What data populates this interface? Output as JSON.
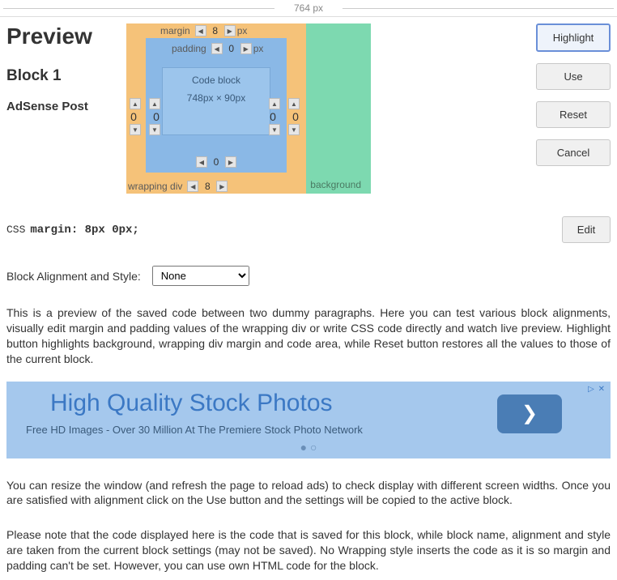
{
  "ruler": "764 px",
  "left": {
    "title": "Preview",
    "block": "Block 1",
    "sub": "AdSense Post"
  },
  "vis": {
    "margin_label": "margin",
    "padding_label": "padding",
    "margin_top": "8",
    "margin_top_unit": "px",
    "padding_top": "0",
    "padding_top_unit": "px",
    "padding_bottom": "0",
    "margin_bottom": "8",
    "left_out": "0",
    "left_in": "0",
    "right_in": "0",
    "right_out": "0",
    "code_label": "Code block",
    "dims": "748px × 90px",
    "wrap_label": "wrapping div",
    "bg_label": "background"
  },
  "buttons": {
    "highlight": "Highlight",
    "use": "Use",
    "reset": "Reset",
    "cancel": "Cancel",
    "edit": "Edit"
  },
  "css": {
    "label": "CSS",
    "value": "margin: 8px 0px;"
  },
  "align": {
    "label": "Block Alignment and Style:",
    "selected": "None"
  },
  "p1": "This is a preview of the saved code between two dummy paragraphs. Here you can test various block alignments, visually edit margin and padding values of the wrapping div or write CSS code directly and watch live preview. Highlight button highlights background, wrapping div margin and code area, while Reset button restores all the values to those of the current block.",
  "ad": {
    "title": "High Quality Stock Photos",
    "sub": "Free HD Images - Over 30 Million At The Premiere Stock Photo Network",
    "close": "▷ ✕"
  },
  "p2": "You can resize the window (and refresh the page to reload ads) to check display with different screen widths. Once you are satisfied with alignment click on the Use button and the settings will be copied to the active block.",
  "p3": "Please note that the code displayed here is the code that is saved for this block, while block name, alignment and style are taken from the current block settings (may not be saved). No Wrapping style inserts the code as it is so margin and padding can't be set. However, you can use own HTML code for the block."
}
